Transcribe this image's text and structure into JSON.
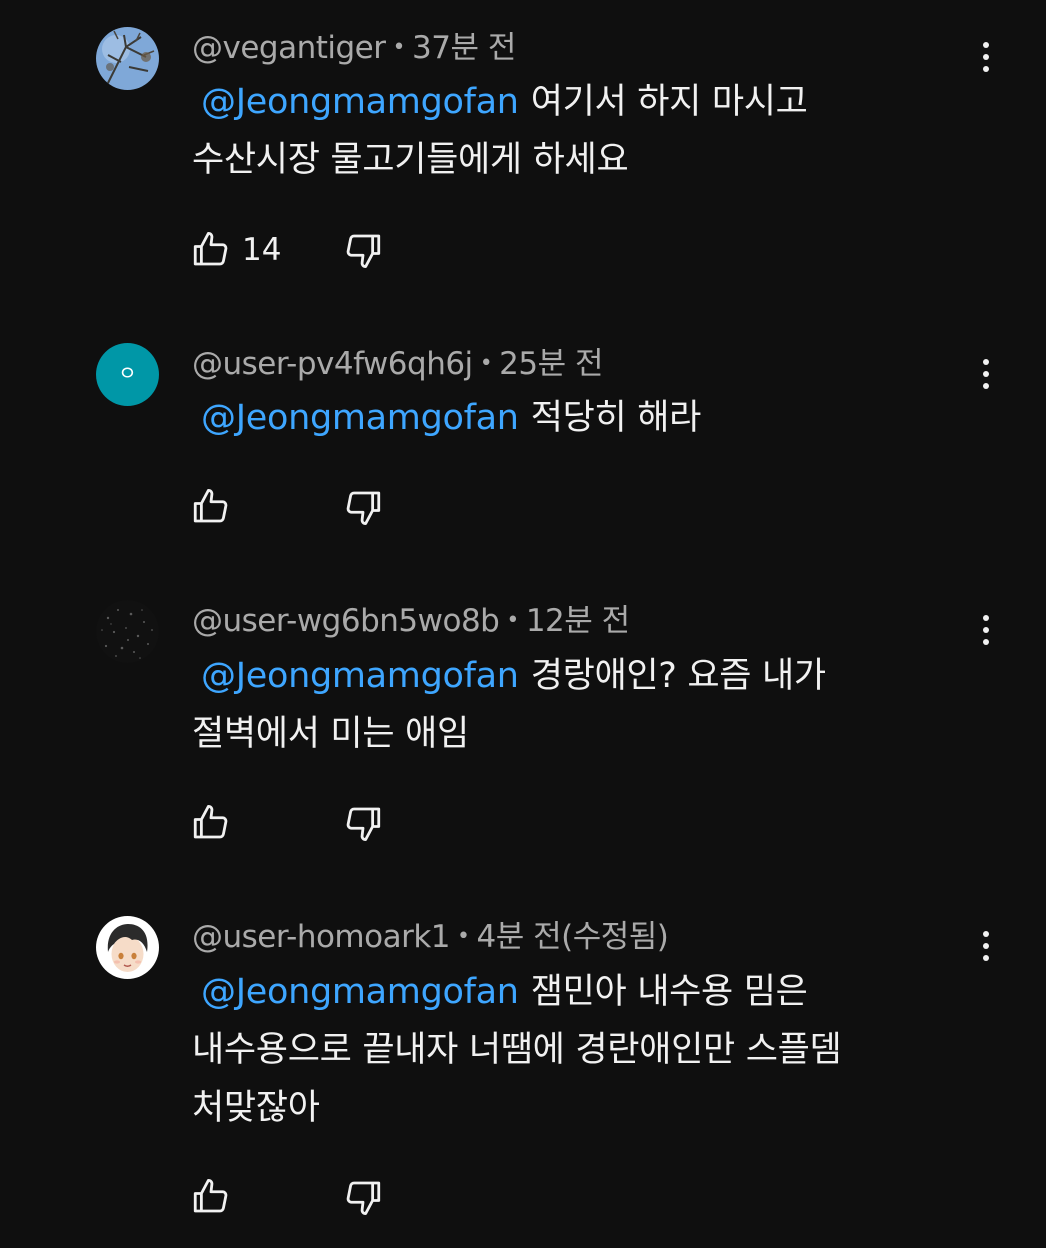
{
  "comments": [
    {
      "author": "@vegantiger",
      "time": "37분 전",
      "mention": "@Jeongmamgofan",
      "lines": [
        "여기서 하지 마시고",
        "수산시장 물고기들에게 하세요"
      ],
      "likes": "14",
      "avatar_icon": "tree-photo-avatar"
    },
    {
      "author": "@user-pv4fw6qh6j",
      "time": "25분 전",
      "mention": "@Jeongmamgofan",
      "lines": [
        "적당히 해라"
      ],
      "likes": "",
      "avatar_letter": "ㅇ",
      "avatar_color": "#0097a7"
    },
    {
      "author": "@user-wg6bn5wo8b",
      "time": "12분 전",
      "mention": "@Jeongmamgofan",
      "lines": [
        "경랑애인? 요즘 내가",
        "절벽에서 미는 애임"
      ],
      "likes": "",
      "avatar_icon": "dark-speckle-avatar"
    },
    {
      "author": "@user-homoark1",
      "time": "4분 전(수정됨)",
      "mention": "@Jeongmamgofan",
      "lines": [
        "잼민아 내수용 밈은",
        "내수용으로 끝내자 너땜에 경란애인만 스플뎀",
        "처맞잖아"
      ],
      "likes": "",
      "avatar_icon": "anime-face-avatar"
    }
  ],
  "icons": {
    "like": "thumbs-up-icon",
    "dislike": "thumbs-down-icon",
    "more": "more-vert-icon"
  },
  "colors": {
    "background": "#0f0f0f",
    "mention": "#3ea6ff",
    "meta": "#aaaaaa",
    "text": "#f1f1f1"
  }
}
